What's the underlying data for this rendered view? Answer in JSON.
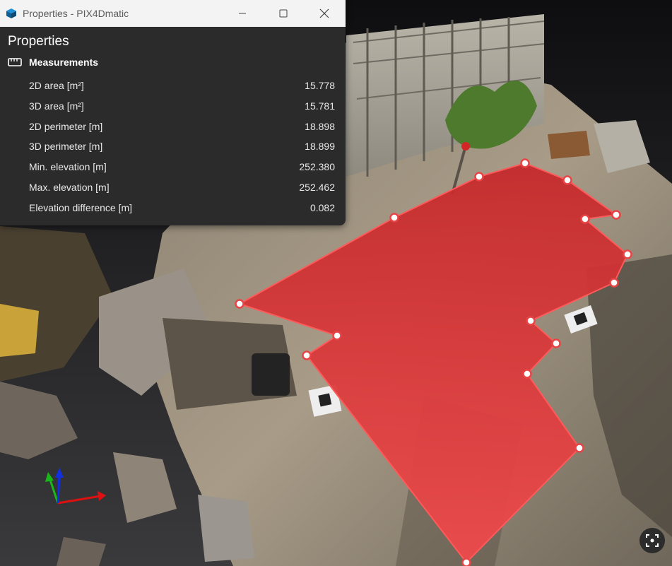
{
  "window": {
    "title": "Properties - PIX4Dmatic",
    "icon": "pix4d-app-icon"
  },
  "panel": {
    "title": "Properties",
    "section": {
      "icon": "ruler-icon",
      "label": "Measurements"
    },
    "measurements": [
      {
        "label": "2D area [m²]",
        "value": "15.778"
      },
      {
        "label": "3D area [m²]",
        "value": "15.781"
      },
      {
        "label": "2D perimeter [m]",
        "value": "18.898"
      },
      {
        "label": "3D perimeter [m]",
        "value": "18.899"
      },
      {
        "label": "Min. elevation [m]",
        "value": "252.380"
      },
      {
        "label": "Max. elevation [m]",
        "value": "252.462"
      },
      {
        "label": "Elevation difference [m]",
        "value": "0.082"
      }
    ]
  },
  "viewport": {
    "polygon_color": "#e84445",
    "vertex_color": "#ffffff",
    "axis_colors": {
      "x": "#e01010",
      "y": "#18b818",
      "z": "#1030e0"
    },
    "fit_view_icon": "fit-view-icon"
  }
}
